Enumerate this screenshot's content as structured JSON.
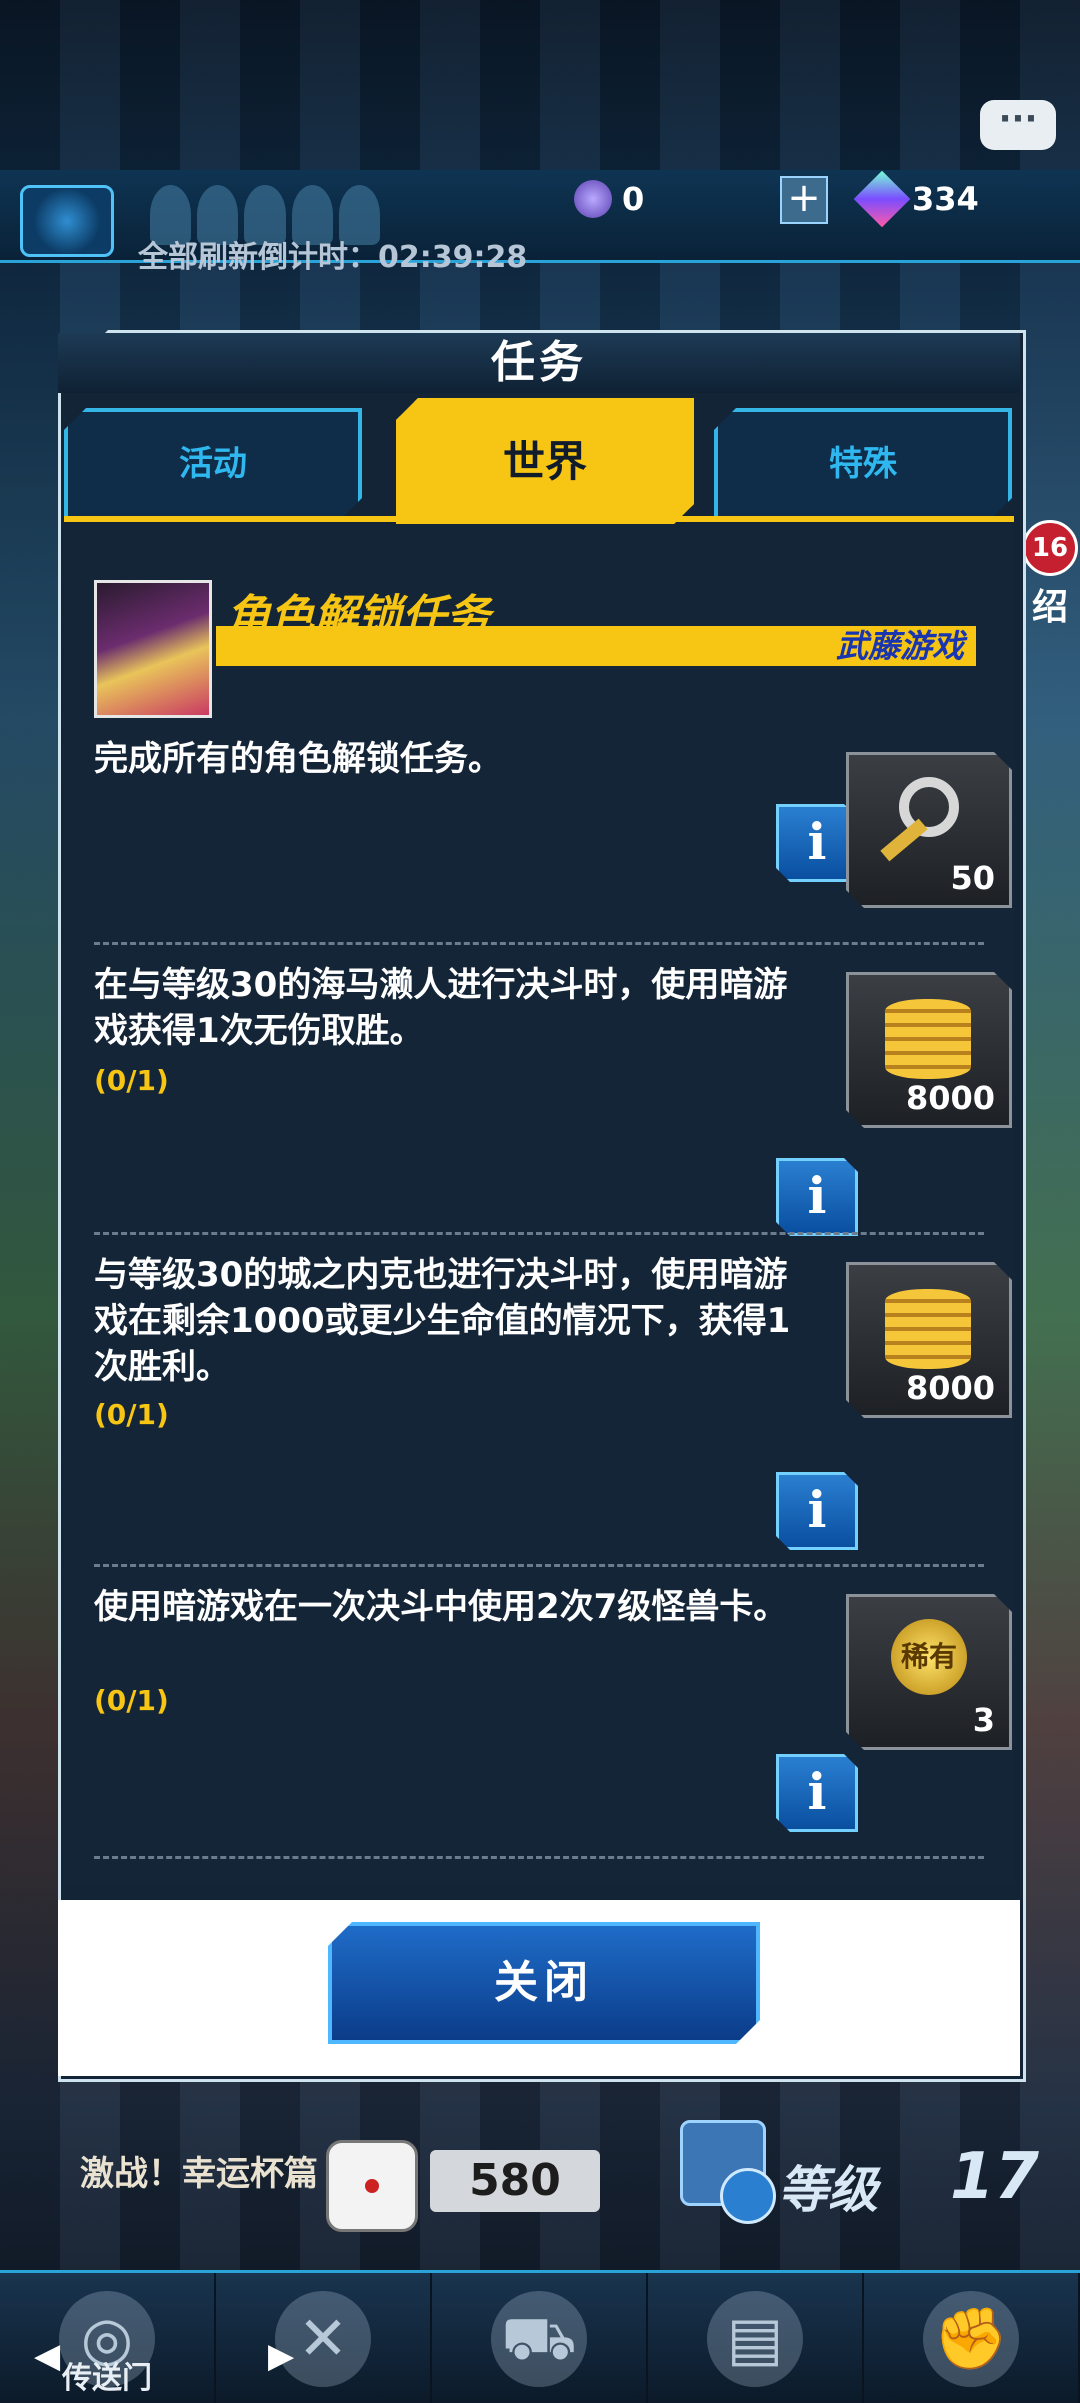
{
  "header": {
    "currency1": "0",
    "currency2": "334",
    "refresh_label": "全部刷新倒计时：",
    "refresh_time": "02:39:28",
    "chat_icon": "···",
    "badge": "16",
    "side_label": "绍"
  },
  "dialog": {
    "title": "任务",
    "tabs": [
      {
        "label": "活动",
        "active": false
      },
      {
        "label": "世界",
        "active": true
      },
      {
        "label": "特殊",
        "active": false
      }
    ],
    "character": {
      "title": "角色解锁任务",
      "name": "武藤游戏"
    },
    "quests": [
      {
        "text": "完成所有的角色解锁任务。",
        "progress": "",
        "reward_icon": "key-icon",
        "reward_count": "50"
      },
      {
        "text": "在与等级30的海马濑人进行决斗时，使用暗游戏获得1次无伤取胜。",
        "progress": "(0/1)",
        "reward_icon": "gold-coins-icon",
        "reward_count": "8000"
      },
      {
        "text": "与等级30的城之内克也进行决斗时，使用暗游戏在剩余1000或更少生命值的情况下，获得1次胜利。",
        "progress": "(0/1)",
        "reward_icon": "gold-coins-icon",
        "reward_count": "8000"
      },
      {
        "text": "使用暗游戏在一次决斗中使用2次7级怪兽卡。",
        "progress": "(0/1)",
        "reward_icon": "rare-medal-icon",
        "reward_label": "稀有",
        "reward_count": "3"
      }
    ],
    "close_label": "关闭"
  },
  "hud": {
    "event_title": "激战！幸运杯篇",
    "dice_count": "580",
    "level_label": "等级",
    "level_value": "17"
  },
  "nav": {
    "items": [
      {
        "label": "传送门",
        "icon": "portal-icon"
      },
      {
        "label": "",
        "icon": "duel-swords-icon"
      },
      {
        "label": "",
        "icon": "shop-cart-icon"
      },
      {
        "label": "",
        "icon": "cards-icon"
      },
      {
        "label": "",
        "icon": "fist-emblem-icon"
      }
    ]
  }
}
